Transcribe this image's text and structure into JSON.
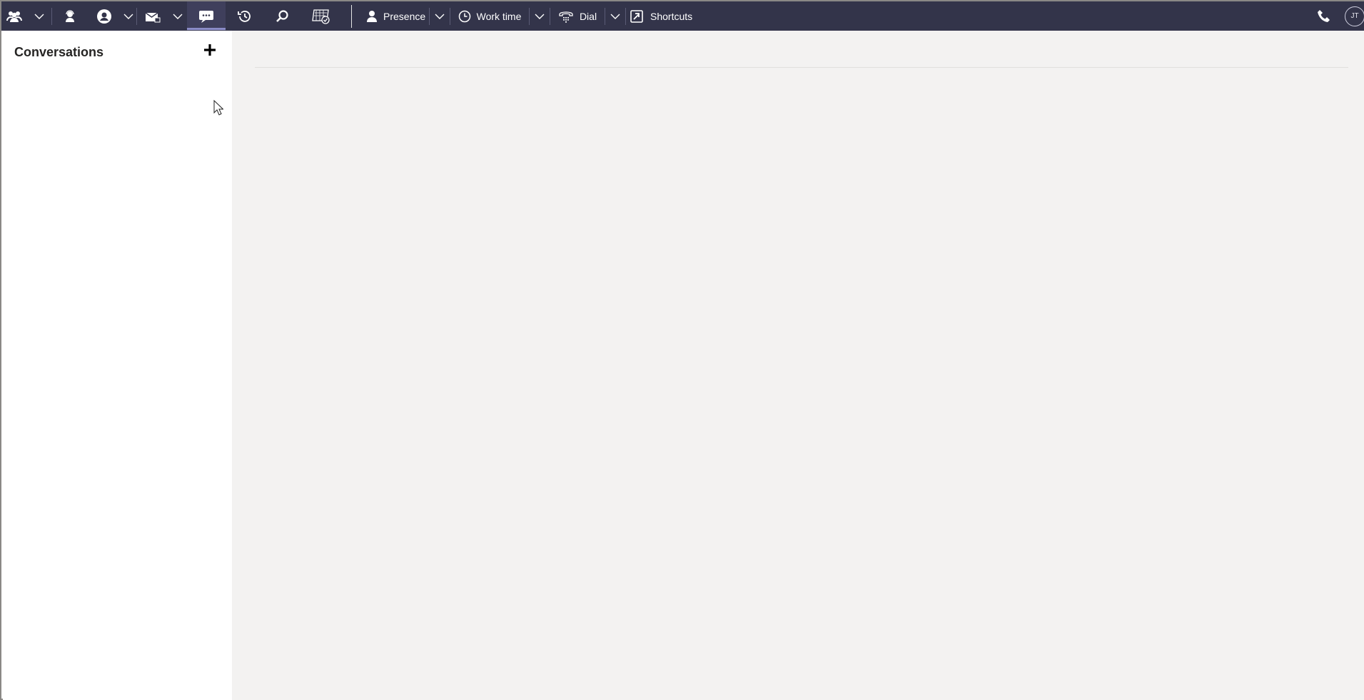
{
  "toolbar": {
    "icons": [
      "team-icon",
      "chevron-down-icon",
      "agent-icon",
      "contact-icon",
      "chevron-down-icon",
      "mail-icon",
      "chevron-down-icon",
      "chat-icon",
      "history-icon",
      "search-icon",
      "calendar-check-icon"
    ],
    "presence_label": "Presence",
    "worktime_label": "Work time",
    "dial_label": "Dial",
    "shortcuts_label": "Shortcuts",
    "avatar_initials": "JT",
    "colors": {
      "background": "#33344a",
      "active_tab": "#3f3f5c",
      "active_indicator": "#8b8cc7"
    }
  },
  "sidebar": {
    "title": "Conversations",
    "add_icon": "plus-icon"
  },
  "main": {
    "background": "#f3f2f1"
  }
}
